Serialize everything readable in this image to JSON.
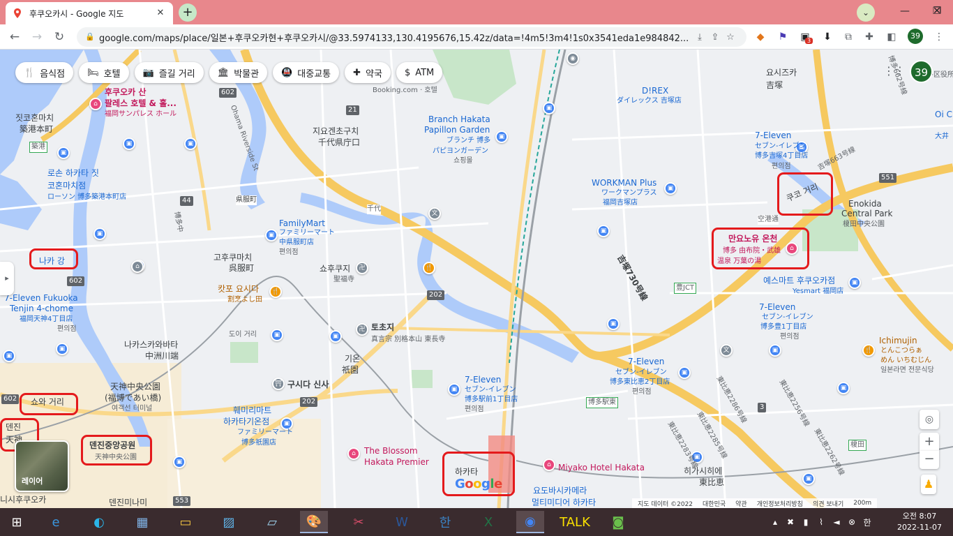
{
  "browser": {
    "tab_title": "후쿠오카시 - Google 지도",
    "new_tab": "+",
    "url": "google.com/maps/place/일본+후쿠오카현+후쿠오카시/@33.5974133,130.4195676,15.42z/data=!4m5!3m4!1s0x3541eda1e984842...",
    "profile_number": "39",
    "ext_badge": "3"
  },
  "chips": [
    {
      "icon": "restaurant-icon",
      "label": "음식점"
    },
    {
      "icon": "hotel-icon",
      "label": "호텔"
    },
    {
      "icon": "camera-icon",
      "label": "즐길 거리"
    },
    {
      "icon": "museum-icon",
      "label": "박물관"
    },
    {
      "icon": "transit-icon",
      "label": "대중교통"
    },
    {
      "icon": "pharmacy-icon",
      "label": "약국"
    },
    {
      "icon": "atm-icon",
      "label": "ATM"
    }
  ],
  "map": {
    "labels": [
      {
        "t": "후쿠오카 산",
        "c": "pink bold"
      },
      {
        "t": "팔레스 호텔 & 홀...",
        "c": "pink bold"
      },
      {
        "t": "福岡サンパレス ホール",
        "c": "pink sm"
      },
      {
        "t": "짓코혼마치",
        "c": "dark"
      },
      {
        "t": "築港本町",
        "c": "dark"
      },
      {
        "t": "로손 하카타 짓",
        "c": "blue"
      },
      {
        "t": "코혼마치점",
        "c": "blue"
      },
      {
        "t": "ローソン 博多築港本町店",
        "c": "blue sm"
      },
      {
        "t": "나카 강",
        "c": "blue"
      },
      {
        "t": "7-Eleven Fukuoka",
        "c": "blue"
      },
      {
        "t": "Tenjin 4-chome",
        "c": "blue"
      },
      {
        "t": "福岡天神4丁目店",
        "c": "blue sm"
      },
      {
        "t": "편의점",
        "c": "sm"
      },
      {
        "t": "쇼와 거리",
        "c": "dark"
      },
      {
        "t": "덴진",
        "c": "dark"
      },
      {
        "t": "天神",
        "c": "dark"
      },
      {
        "t": "덴진중앙공원",
        "c": "dark bold"
      },
      {
        "t": "天神中央公園",
        "c": "sm"
      },
      {
        "t": "天神中央公園",
        "c": "dark"
      },
      {
        "t": "(福博であい橋)",
        "c": "dark"
      },
      {
        "t": "여객선 터미널",
        "c": "sm"
      },
      {
        "t": "나카스카와바타",
        "c": "dark"
      },
      {
        "t": "中洲川端",
        "c": "dark"
      },
      {
        "t": "덴진미나미",
        "c": "dark"
      },
      {
        "t": "니시후쿠오카",
        "c": "dark"
      },
      {
        "t": "지요겐초구치",
        "c": "dark"
      },
      {
        "t": "千代県庁口",
        "c": "dark"
      },
      {
        "t": "Branch Hakata",
        "c": "blue"
      },
      {
        "t": "Papillon Garden",
        "c": "blue"
      },
      {
        "t": "ブランチ 博多",
        "c": "blue sm"
      },
      {
        "t": "パピヨンガーデン",
        "c": "blue sm"
      },
      {
        "t": "쇼핑몰",
        "c": "sm"
      },
      {
        "t": "Booking.com · 호텔",
        "c": "sm"
      },
      {
        "t": "FamilyMart",
        "c": "blue"
      },
      {
        "t": "ファミリーマート",
        "c": "blue sm"
      },
      {
        "t": "中県服町店",
        "c": "blue sm"
      },
      {
        "t": "편의점",
        "c": "sm"
      },
      {
        "t": "県服町",
        "c": "dark sm"
      },
      {
        "t": "고후쿠마치",
        "c": "dark"
      },
      {
        "t": "呉服町",
        "c": "dark"
      },
      {
        "t": "캇포 요시다",
        "c": "orange"
      },
      {
        "t": "割烹よし田",
        "c": "orange sm"
      },
      {
        "t": "쇼후쿠지",
        "c": "dark"
      },
      {
        "t": "聖福寺",
        "c": "sm"
      },
      {
        "t": "도이 거리",
        "c": "sm"
      },
      {
        "t": "토초지",
        "c": "dark bold"
      },
      {
        "t": "真言宗 別格本山 東長寺",
        "c": "sm"
      },
      {
        "t": "기온",
        "c": "dark"
      },
      {
        "t": "祇園",
        "c": "dark"
      },
      {
        "t": "구시다 신사",
        "c": "dark bold"
      },
      {
        "t": "훼미리마트",
        "c": "blue"
      },
      {
        "t": "하카타기온점",
        "c": "blue"
      },
      {
        "t": "ファミリーマート",
        "c": "blue sm"
      },
      {
        "t": "博多祇園店",
        "c": "blue sm"
      },
      {
        "t": "The Blossom",
        "c": "pink"
      },
      {
        "t": "Hakata Premier",
        "c": "pink"
      },
      {
        "t": "7-Eleven",
        "c": "blue"
      },
      {
        "t": "セブン-イレブン",
        "c": "blue sm"
      },
      {
        "t": "博多駅前1丁目店",
        "c": "blue sm"
      },
      {
        "t": "편의점",
        "c": "sm"
      },
      {
        "t": "하카타",
        "c": "dark"
      },
      {
        "t": "Miyako Hotel Hakata",
        "c": "pink"
      },
      {
        "t": "요도바시카메라",
        "c": "blue"
      },
      {
        "t": "멀티미디어 하카타",
        "c": "blue"
      },
      {
        "t": "千代",
        "c": "sm"
      },
      {
        "t": "D!REX",
        "c": "blue"
      },
      {
        "t": "ダイレックス 吉塚店",
        "c": "blue sm"
      },
      {
        "t": "요시즈카",
        "c": "dark"
      },
      {
        "t": "吉塚",
        "c": "dark"
      },
      {
        "t": "WORKMAN Plus",
        "c": "blue"
      },
      {
        "t": "ワークマンプラス",
        "c": "blue sm"
      },
      {
        "t": "福岡吉塚店",
        "c": "blue sm"
      },
      {
        "t": "7-Eleven",
        "c": "blue"
      },
      {
        "t": "セブン-イレブン",
        "c": "blue sm"
      },
      {
        "t": "博多吉塚4丁目店",
        "c": "blue sm"
      },
      {
        "t": "편의점",
        "c": "sm"
      },
      {
        "t": "쿠코 거리",
        "c": "dark"
      },
      {
        "t": "Enokida",
        "c": "dark"
      },
      {
        "t": "Central Park",
        "c": "dark"
      },
      {
        "t": "榎田中央公園",
        "c": "sm"
      },
      {
        "t": "空港通",
        "c": "sm"
      },
      {
        "t": "만요노유 온천",
        "c": "pink bold"
      },
      {
        "t": "博多 由布院・武雄",
        "c": "pink sm"
      },
      {
        "t": "温泉 万葉の湯",
        "c": "pink sm"
      },
      {
        "t": "吉塚730号線",
        "c": "dark bold"
      },
      {
        "t": "豊JCT",
        "c": "sm"
      },
      {
        "t": "예스마트 후쿠오카점",
        "c": "blue"
      },
      {
        "t": "Yesmart 福岡店",
        "c": "blue sm"
      },
      {
        "t": "7-Eleven",
        "c": "blue"
      },
      {
        "t": "セブン-イレブン",
        "c": "blue sm"
      },
      {
        "t": "博多豊1丁目店",
        "c": "blue sm"
      },
      {
        "t": "편의점",
        "c": "sm"
      },
      {
        "t": "Ichimujin",
        "c": "orange"
      },
      {
        "t": "とんこつらぁ",
        "c": "orange sm"
      },
      {
        "t": "めん いちむじん",
        "c": "orange sm"
      },
      {
        "t": "일본라면 전문식당",
        "c": "sm"
      },
      {
        "t": "7-Eleven",
        "c": "blue"
      },
      {
        "t": "セブン-イレブン",
        "c": "blue sm"
      },
      {
        "t": "博多東比恵2丁目店",
        "c": "blue sm"
      },
      {
        "t": "편의점",
        "c": "sm"
      },
      {
        "t": "博多駅東",
        "c": "sm"
      },
      {
        "t": "히가시히에",
        "c": "dark"
      },
      {
        "t": "東比恵",
        "c": "dark"
      },
      {
        "t": "博多662号線",
        "c": "sm"
      },
      {
        "t": "吉塚663号線",
        "c": "sm"
      },
      {
        "t": "東比恵2286号線",
        "c": "sm"
      },
      {
        "t": "東比恵2285号線",
        "c": "sm"
      },
      {
        "t": "東比恵2283号線",
        "c": "sm"
      },
      {
        "t": "東比恵2262号線",
        "c": "sm"
      },
      {
        "t": "東比恵2256号線",
        "c": "sm"
      },
      {
        "t": "Oi C",
        "c": "blue"
      },
      {
        "t": "大井",
        "c": "blue sm"
      },
      {
        "t": "博多区役所",
        "c": "sm"
      },
      {
        "t": "築港",
        "c": "sm"
      },
      {
        "t": "榎田",
        "c": "sm"
      },
      {
        "t": "Ohama Riverside St",
        "c": "sm"
      },
      {
        "t": "博多中",
        "c": "sm"
      },
      {
        "t": "嶋前",
        "c": "sm"
      }
    ],
    "shields": [
      "602",
      "21",
      "44",
      "602",
      "202",
      "202",
      "602",
      "553",
      "551",
      "3"
    ],
    "layer_label": "레이어",
    "footer": [
      "지도 데이터 ©2022",
      "대한민국",
      "약관",
      "개인정보처리방침",
      "의견 보내기",
      "200m"
    ],
    "google_logo": "Google",
    "avatar": "39"
  },
  "taskbar": {
    "time": "오전 8:07",
    "date": "2022-11-07",
    "ime": "한"
  }
}
